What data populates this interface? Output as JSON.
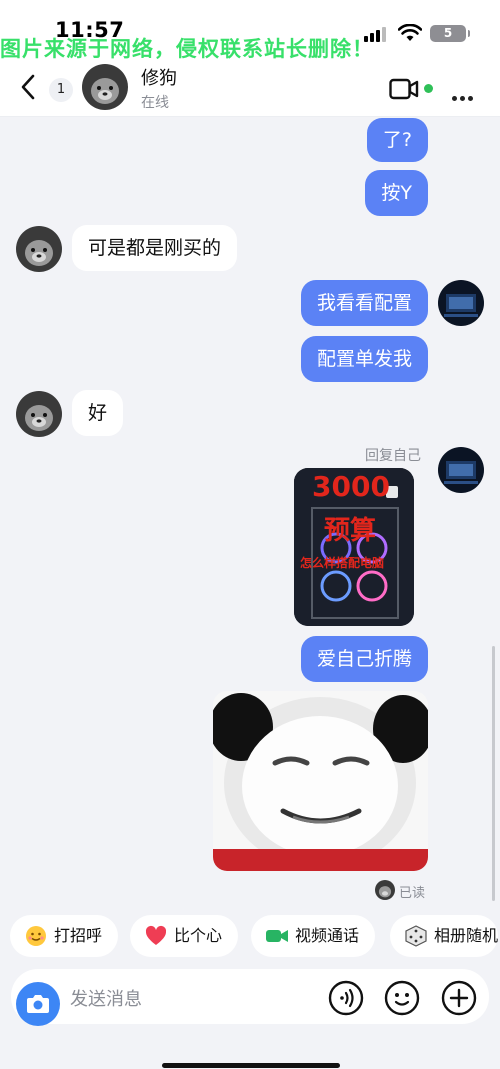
{
  "status_bar": {
    "time": "11:57",
    "battery": "5"
  },
  "watermark": "图片来源于网络，侵权联系站长删除！",
  "header": {
    "unread_count": "1",
    "contact_name": "修狗",
    "status": "在线"
  },
  "messages": [
    {
      "side": "out",
      "text": "了?"
    },
    {
      "side": "out",
      "text": "按Y"
    },
    {
      "side": "in",
      "text": "可是都是刚买的"
    },
    {
      "side": "out",
      "text": "我看看配置"
    },
    {
      "side": "out",
      "text": "配置单发我"
    },
    {
      "side": "in",
      "text": "好"
    },
    {
      "side": "out",
      "type": "image",
      "reply_label": "回复自己",
      "image_text": [
        "3000",
        "预算",
        "怎么样搭配电脑"
      ]
    },
    {
      "side": "out",
      "text": "爱自己折腾"
    },
    {
      "side": "out",
      "type": "sticker",
      "sticker": "panda-meme"
    }
  ],
  "read_receipt": "已读",
  "quick_actions": [
    {
      "label": "打招呼",
      "icon": "wave-face-icon"
    },
    {
      "label": "比个心",
      "icon": "heart-icon"
    },
    {
      "label": "视频通话",
      "icon": "video-icon"
    },
    {
      "label": "相册随机",
      "icon": "dice-icon"
    }
  ],
  "input": {
    "placeholder": "发送消息"
  },
  "colors": {
    "accent": "#5b82f5",
    "online": "#2fc058",
    "watermark": "#38e06a",
    "camera": "#3d86f5"
  }
}
